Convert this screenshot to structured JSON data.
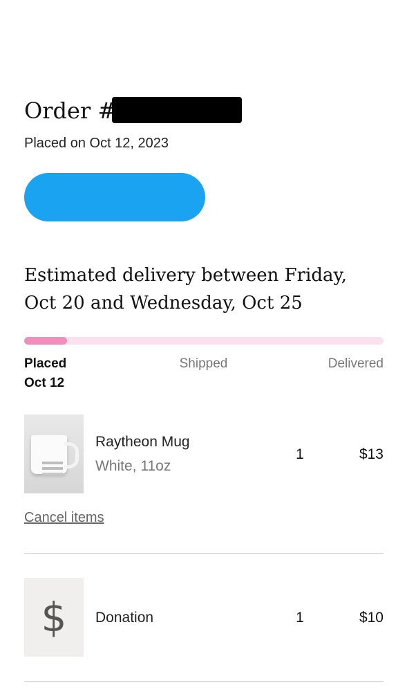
{
  "order": {
    "heading_prefix": "Order #",
    "placed_on": "Placed on Oct 12, 2023",
    "delivery_estimate": "Estimated delivery between Friday, Oct 20 and Wednesday, Oct 25"
  },
  "progress": {
    "fraction": 0.12,
    "stages": [
      {
        "label": "Placed",
        "date": "Oct 12",
        "active": true
      },
      {
        "label": "Shipped"
      },
      {
        "label": "Delivered"
      }
    ]
  },
  "items": [
    {
      "name": "Raytheon Mug",
      "variant": "White, 11oz",
      "quantity": "1",
      "price": "$13",
      "icon": "mug-image"
    },
    {
      "name": "Donation",
      "quantity": "1",
      "price": "$10",
      "icon": "dollar-icon"
    }
  ],
  "cancel_label": "Cancel items",
  "colors": {
    "button": "#1aa3f0",
    "progress_track": "#fbe1ee",
    "progress_fill": "#f28dbd"
  }
}
